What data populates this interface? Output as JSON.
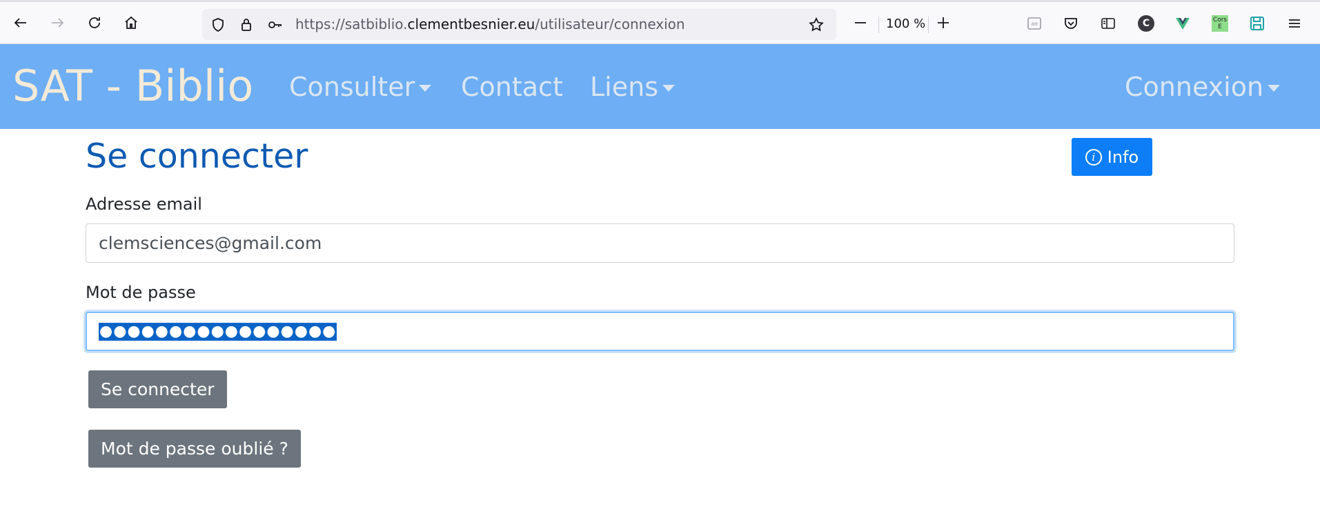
{
  "browser": {
    "url_prefix": "https://satbiblio.",
    "url_domain": "clementbesnier.eu",
    "url_path": "/utilisateur/connexion",
    "zoom": "100 %",
    "icons": [
      "back-icon",
      "forward-icon",
      "reload-icon",
      "home-icon",
      "shield-icon",
      "lock-icon",
      "key-icon",
      "star-icon",
      "reader-icon",
      "pocket-icon",
      "sidebar-icon",
      "c-extension-icon",
      "vue-devtools-icon",
      "cors-extension-icon",
      "save-icon",
      "menu-icon"
    ],
    "cors_label_line1": "Cors",
    "cors_label_line2": "E",
    "c_label": "C"
  },
  "navbar": {
    "brand": "SAT - Biblio",
    "consulter": "Consulter",
    "contact": "Contact",
    "liens": "Liens",
    "connexion": "Connexion",
    "background": "#6daef4"
  },
  "main": {
    "title": "Se connecter",
    "info_button": "Info",
    "info_icon_glyph": "i",
    "email_label": "Adresse email",
    "email_value": "clemsciences@gmail.com",
    "password_label": "Mot de passe",
    "password_mask": "●●●●●●●●●●●●●●●●●",
    "submit_button": "Se connecter",
    "forgot_button": "Mot de passe oublié ?"
  },
  "colors": {
    "title": "#0e5ab2",
    "info_button": "#0d7ef8",
    "secondary_button": "#6c757d"
  }
}
